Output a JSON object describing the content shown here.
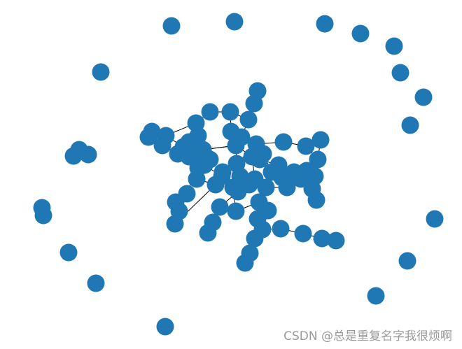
{
  "graph": {
    "node_color": "#1f77b4",
    "edge_color": "#000000",
    "node_count": 96,
    "edge_count": 104
  },
  "watermark": "CSDN @总是重复名字我很烦啊"
}
